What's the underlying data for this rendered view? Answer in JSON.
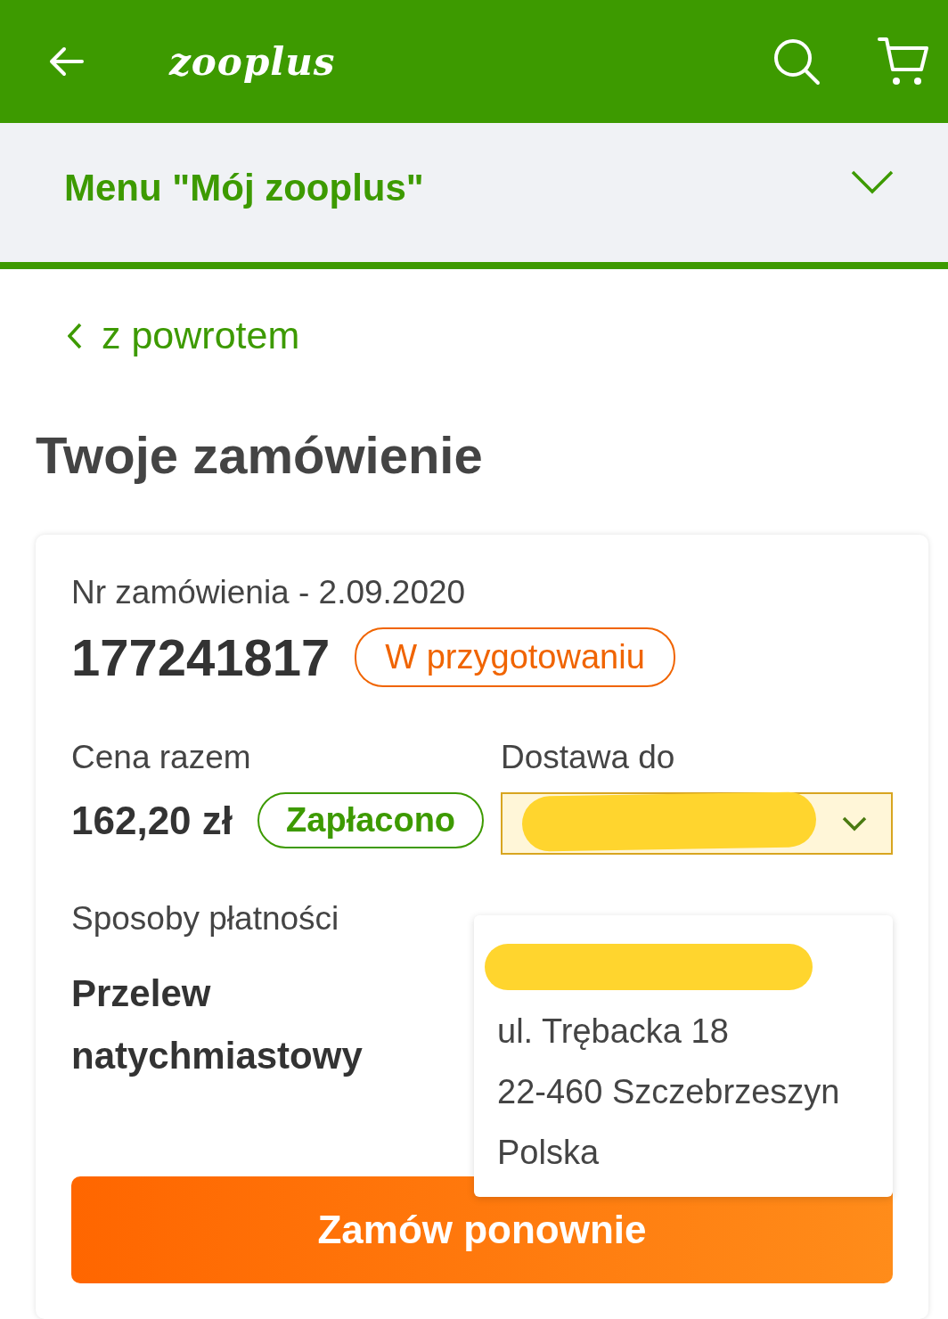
{
  "header": {
    "logo": "zooplus"
  },
  "menu": {
    "label": "Menu \"Mój zooplus\"",
    "expanded": false
  },
  "back_link": "z powrotem",
  "title": "Twoje zamówienie",
  "order": {
    "number_label": "Nr zamówienia - 2.09.2020",
    "number": "177241817",
    "status": "W przygotowaniu",
    "total_label": "Cena razem",
    "total": "162,20 zł",
    "payment_status": "Zapłacono",
    "delivery_label": "Dostawa do",
    "delivery_dropdown": {
      "expanded": true,
      "address_lines": [
        "ul. Trębacka 18",
        "22-460 Szczebrzeszyn",
        "Polska"
      ]
    },
    "payment_method_label": "Sposoby płatności",
    "payment_method": "Przelew natychmiastowy"
  },
  "reorder_button": "Zamów ponownie"
}
